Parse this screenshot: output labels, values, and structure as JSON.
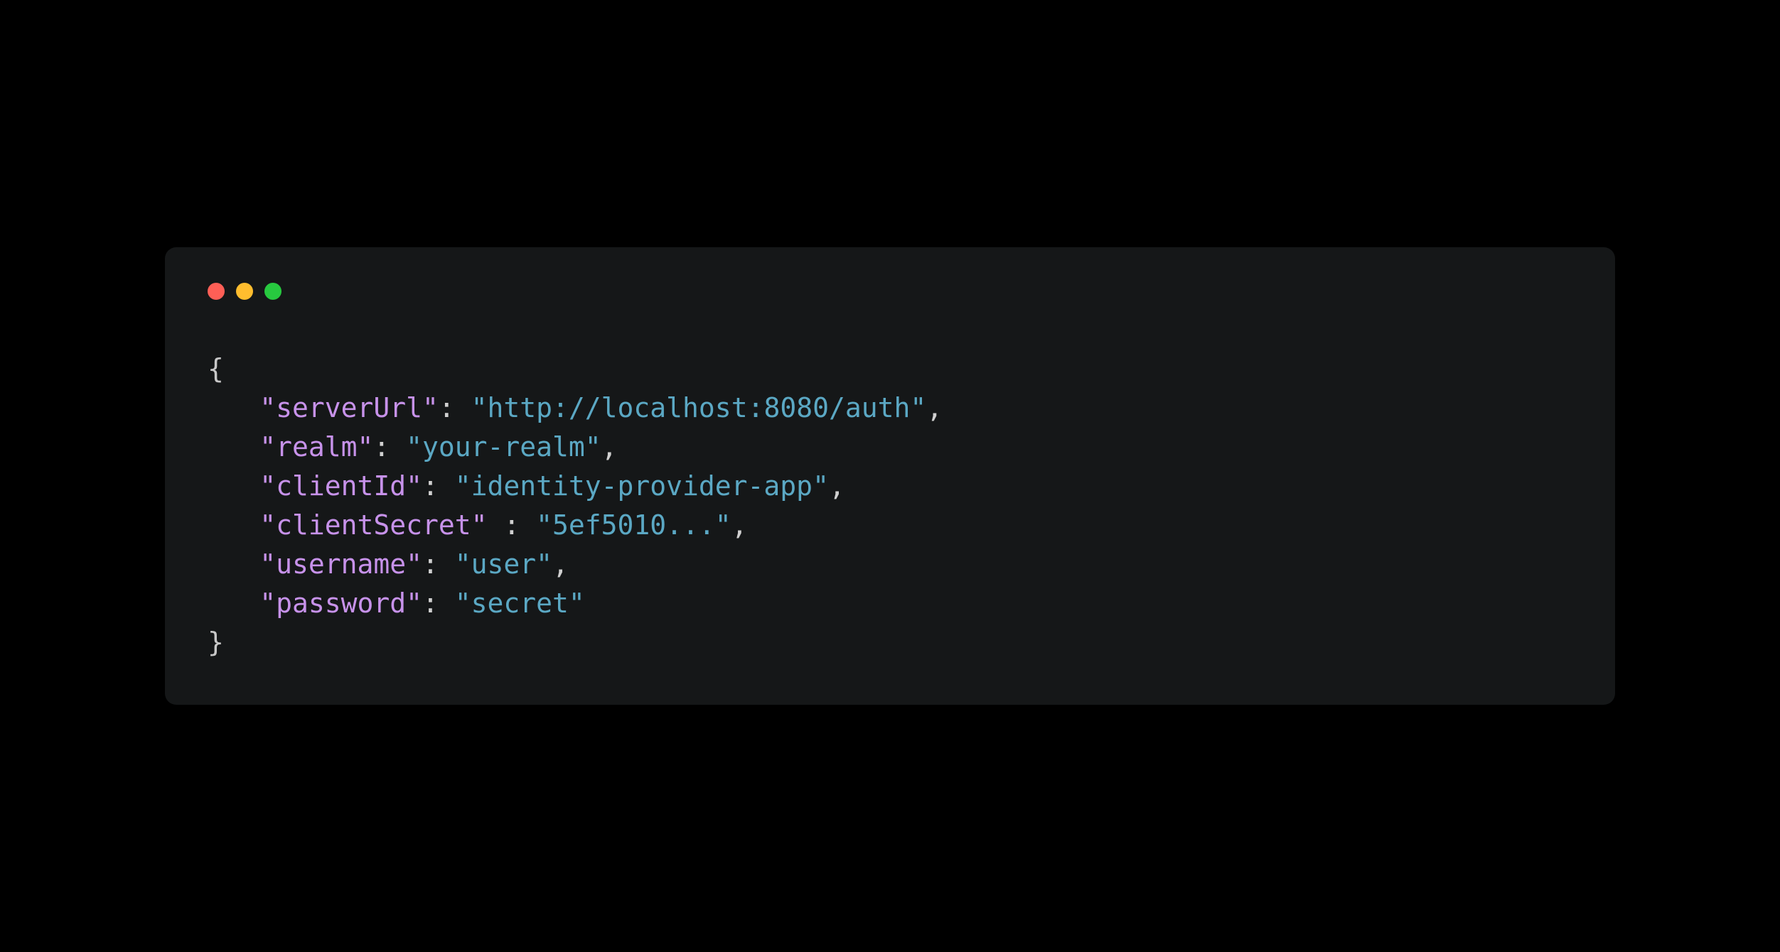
{
  "code": {
    "braceOpen": "{",
    "braceClose": "}",
    "entries": [
      {
        "key": "\"serverUrl\"",
        "sep": ": ",
        "value": "\"http://localhost:8080/auth\"",
        "trail": ","
      },
      {
        "key": "\"realm\"",
        "sep": ": ",
        "value": "\"your-realm\"",
        "trail": ","
      },
      {
        "key": "\"clientId\"",
        "sep": ": ",
        "value": "\"identity-provider-app\"",
        "trail": ","
      },
      {
        "key": "\"clientSecret\"",
        "sep": " : ",
        "value": "\"5ef5010...\"",
        "trail": ","
      },
      {
        "key": "\"username\"",
        "sep": ": ",
        "value": "\"user\"",
        "trail": ","
      },
      {
        "key": "\"password\"",
        "sep": ": ",
        "value": "\"secret\"",
        "trail": ""
      }
    ]
  },
  "colors": {
    "background": "#000000",
    "windowBg": "#151718",
    "key": "#c792ea",
    "string": "#5ba8c4",
    "brace": "#c8c8c8",
    "trafficRed": "#ff5f56",
    "trafficYellow": "#ffbd2e",
    "trafficGreen": "#27c93f"
  }
}
